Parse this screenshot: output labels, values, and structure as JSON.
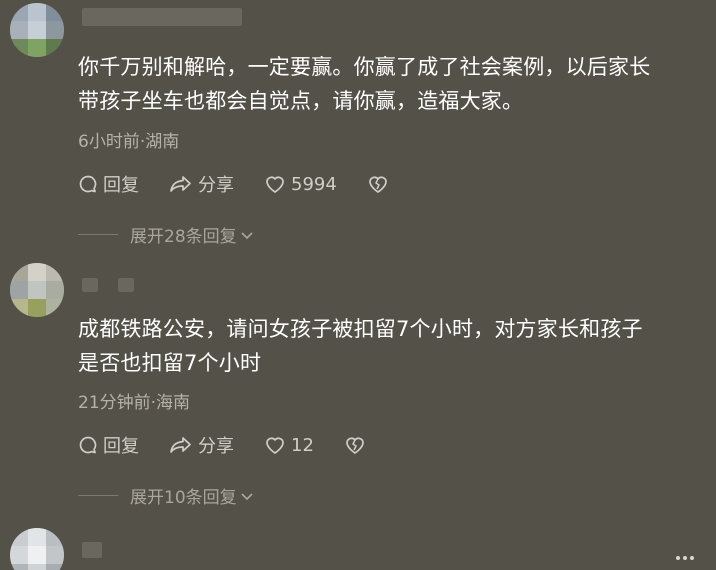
{
  "comments": [
    {
      "text_line1": "你千万别和解哈，一定要赢。你赢了成了社会案例，以后家长",
      "text_line2": "带孩子坐车也都会自觉点，请你赢，造福大家。",
      "meta": "6小时前·湖南",
      "reply_label": "回复",
      "share_label": "分享",
      "like_count": "5994",
      "expand_label": "展开28条回复"
    },
    {
      "text_line1": "成都铁路公安，请问女孩子被扣留7个小时，对方家长和孩子",
      "text_line2": "是否也扣留7个小时",
      "meta": "21分钟前·海南",
      "reply_label": "回复",
      "share_label": "分享",
      "like_count": "12",
      "expand_label": "展开10条回复"
    }
  ],
  "colors": {
    "background": "#545148",
    "text": "#ffffff",
    "meta": "#b5b2aa"
  }
}
